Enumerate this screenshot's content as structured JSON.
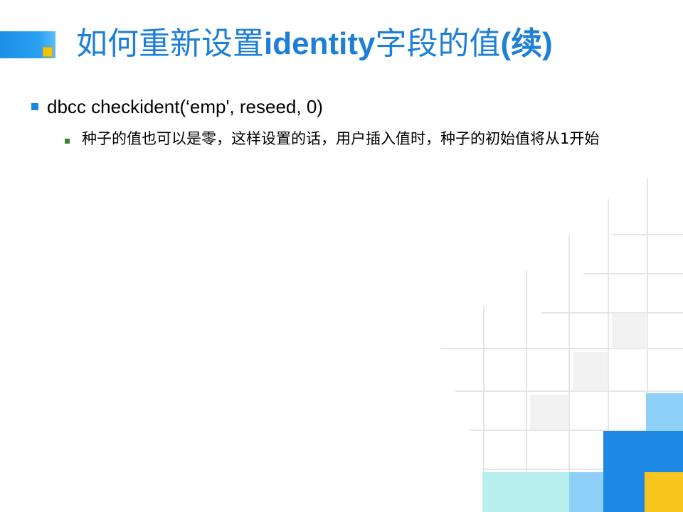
{
  "slide": {
    "title_cn_prefix": "如何重新设置",
    "title_latin": "identity",
    "title_cn_suffix": "字段的值",
    "title_paren": "(续)",
    "bullets": [
      {
        "text": "dbcc checkident(‘emp', reseed, 0)",
        "sub_bullets": [
          {
            "text": "种子的值也可以是零，这样设置的话，用户插入值时，种子的初始值将从1开始"
          }
        ]
      }
    ]
  },
  "colors": {
    "title": "#1e7fd6",
    "title_bar": "#1a8fe8",
    "title_square": "#f5c400",
    "bullet_level1": "#1a87e0",
    "bullet_level2": "#2e8b2e",
    "deco_blue": "#1e88e5",
    "deco_light_blue": "#8fd0f8",
    "deco_cyan": "#b8f0f0",
    "deco_yellow": "#f7c51e"
  }
}
